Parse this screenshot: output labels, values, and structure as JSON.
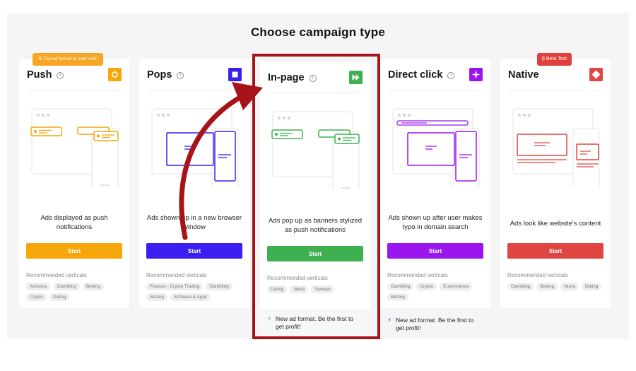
{
  "page": {
    "title": "Choose campaign type"
  },
  "badges": {
    "top_format": "Top ad format to start with!",
    "beta": "Beta Test"
  },
  "colors": {
    "push": "#f6a609",
    "pops": "#3b1ef0",
    "inpage": "#3fb04f",
    "direct": "#9b16ee",
    "native": "#e04641",
    "highlight": "#a6141a"
  },
  "cards": [
    {
      "name": "Push",
      "icon": "push-square-icon",
      "description": "Ads displayed as push notifications",
      "button": "Start",
      "recommended_label": "Recommended verticals",
      "tags": [
        "Antivirus",
        "Gambling",
        "Betting",
        "Crypto",
        "Dating"
      ]
    },
    {
      "name": "Pops",
      "icon": "pops-square-icon",
      "description": "Ads shown up in a new browser window",
      "button": "Start",
      "recommended_label": "Recommended verticals",
      "tags": [
        "Finance - Crypto Trading",
        "Gambling",
        "Betting",
        "Software & Apps"
      ]
    },
    {
      "name": "In-page",
      "icon": "fast-forward-icon",
      "description": "Ads pop up as banners stylized as push notifications",
      "button": "Start",
      "recommended_label": "Recommended verticals",
      "tags": [
        "Dating",
        "Nutra",
        "Sweeps"
      ],
      "footer": "New ad format. Be the first to get profit!"
    },
    {
      "name": "Direct click",
      "icon": "sparkle-icon",
      "description": "Ads shown up after user makes typo in domain search",
      "button": "Start",
      "recommended_label": "Recommended verticals",
      "tags": [
        "Gambling",
        "Crypto",
        "E-commerce",
        "Betting"
      ],
      "footer": "New ad format. Be the first to get profit!"
    },
    {
      "name": "Native",
      "icon": "diamond-icon",
      "description": "Ads look like website's content",
      "button": "Start",
      "recommended_label": "Recommended verticals",
      "tags": [
        "Gambling",
        "Betting",
        "Nutra",
        "Dating"
      ]
    }
  ]
}
